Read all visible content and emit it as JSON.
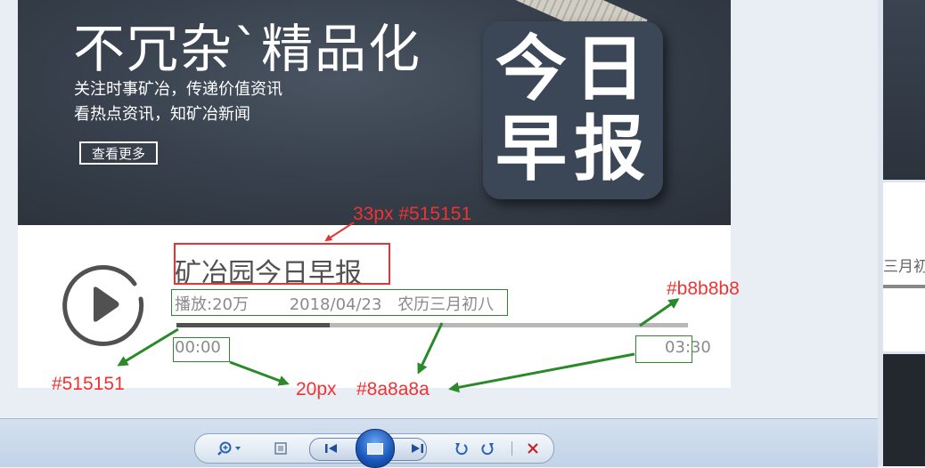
{
  "banner": {
    "title": "不冗杂`精品化",
    "line1": "关注时事矿冶，传递价值资讯",
    "line2": "看热点资讯，知矿冶新闻",
    "more_button": "查看更多",
    "logo_chars": [
      "今",
      "日",
      "早",
      "报"
    ]
  },
  "player": {
    "title": "矿冶园今日早报",
    "plays": "播放:20万",
    "date": "2018/04/23",
    "lunar": "农历三月初八",
    "current_time": "00:00",
    "total_time": "03:30",
    "progress_fraction": 0.3
  },
  "annotations": {
    "title_spec": "33px  #515151",
    "track_color": "#b8b8b8",
    "fill_color": "#515151",
    "time_size": "20px",
    "meta_color": "#8a8a8a"
  },
  "right_panel": {
    "partial_text": "三月初"
  },
  "toolbar": {
    "zoom_icon": "magnifier-zoom-icon",
    "fit_icon": "actual-size-icon",
    "prev_icon": "previous-icon",
    "slideshow_icon": "slideshow-icon",
    "next_icon": "next-icon",
    "rotate_left_icon": "rotate-ccw-icon",
    "rotate_right_icon": "rotate-cw-icon",
    "delete_icon": "delete-icon"
  },
  "colors": {
    "title": "#515151",
    "meta": "#8a8a8a",
    "track": "#b8b8b8",
    "annotation_red": "#ee3333",
    "annotation_green": "#2a8a2a"
  }
}
